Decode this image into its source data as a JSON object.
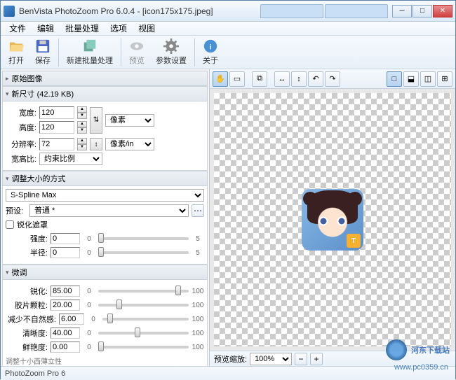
{
  "titlebar": {
    "app_title": "BenVista PhotoZoom Pro 6.0.4 - [icon175x175.jpeg]"
  },
  "menu": {
    "items": [
      "文件",
      "编辑",
      "批量处理",
      "选项",
      "视图"
    ]
  },
  "toolbar": {
    "open": "打开",
    "save": "保存",
    "batch": "新建批量处理",
    "preview": "预览",
    "params": "参数设置",
    "about": "关于"
  },
  "panels": {
    "original": "原始图像",
    "newsize": "新尺寸 (42.19 KB)",
    "resize_method": "调整大小的方式",
    "fine_tuning": "微调"
  },
  "size": {
    "width_label": "宽度:",
    "width_value": "120",
    "height_label": "高度:",
    "height_value": "120",
    "res_label": "分辨率:",
    "res_value": "72",
    "aspect_label": "宽高比:",
    "unit_pixel": "像素",
    "unit_pixel_in": "像素/in",
    "aspect_value": "约束比例"
  },
  "resize": {
    "method": "S-Spline Max",
    "preset_label": "预设:",
    "preset_value": "普通 *",
    "sharpen_mask": "锐化遮罩",
    "intensity_label": "强度:",
    "intensity_value": "0",
    "radius_label": "半径:",
    "radius_value": "0"
  },
  "tuning": {
    "sharpen_label": "锐化:",
    "sharpen_value": "85.00",
    "grain_label": "胶片颗粒:",
    "grain_value": "20.00",
    "artifact_label": "减少不自然感:",
    "artifact_value": "6.00",
    "clarity_label": "清晰度:",
    "clarity_value": "40.00",
    "vivid_label": "鲜艳度:",
    "vivid_value": "0.00",
    "min": "0",
    "max": "100",
    "slider_min": "0",
    "slider_max": "5",
    "footer_text": "调整十小西薄立性"
  },
  "canvas": {
    "zoom_label": "预览缩放:",
    "zoom_value": "100%"
  },
  "status": {
    "text": "PhotoZoom Pro 6"
  },
  "watermark": {
    "text": "河东下载站",
    "url": "www.pc0359.cn"
  }
}
